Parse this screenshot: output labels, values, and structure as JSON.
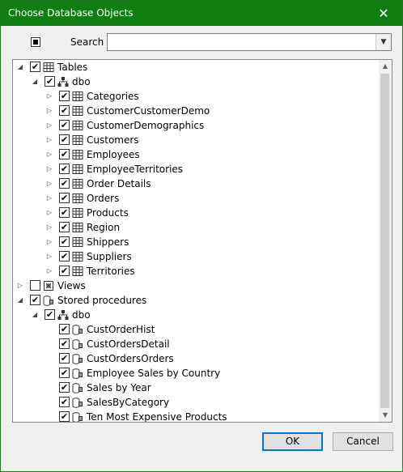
{
  "window": {
    "title": "Choose Database Objects"
  },
  "search": {
    "label": "Search",
    "value": ""
  },
  "buttons": {
    "ok": "OK",
    "cancel": "Cancel"
  },
  "tree": [
    {
      "level": 0,
      "expand": "expanded",
      "checked": true,
      "icon": "table-icon",
      "label": "Tables"
    },
    {
      "level": 1,
      "expand": "expanded",
      "checked": true,
      "icon": "schema-icon",
      "label": "dbo"
    },
    {
      "level": 2,
      "expand": "collapsed",
      "checked": true,
      "icon": "table-icon",
      "label": "Categories"
    },
    {
      "level": 2,
      "expand": "collapsed",
      "checked": true,
      "icon": "table-icon",
      "label": "CustomerCustomerDemo"
    },
    {
      "level": 2,
      "expand": "collapsed",
      "checked": true,
      "icon": "table-icon",
      "label": "CustomerDemographics"
    },
    {
      "level": 2,
      "expand": "collapsed",
      "checked": true,
      "icon": "table-icon",
      "label": "Customers"
    },
    {
      "level": 2,
      "expand": "collapsed",
      "checked": true,
      "icon": "table-icon",
      "label": "Employees"
    },
    {
      "level": 2,
      "expand": "collapsed",
      "checked": true,
      "icon": "table-icon",
      "label": "EmployeeTerritories"
    },
    {
      "level": 2,
      "expand": "collapsed",
      "checked": true,
      "icon": "table-icon",
      "label": "Order Details"
    },
    {
      "level": 2,
      "expand": "collapsed",
      "checked": true,
      "icon": "table-icon",
      "label": "Orders"
    },
    {
      "level": 2,
      "expand": "collapsed",
      "checked": true,
      "icon": "table-icon",
      "label": "Products"
    },
    {
      "level": 2,
      "expand": "collapsed",
      "checked": true,
      "icon": "table-icon",
      "label": "Region"
    },
    {
      "level": 2,
      "expand": "collapsed",
      "checked": true,
      "icon": "table-icon",
      "label": "Shippers"
    },
    {
      "level": 2,
      "expand": "collapsed",
      "checked": true,
      "icon": "table-icon",
      "label": "Suppliers"
    },
    {
      "level": 2,
      "expand": "collapsed",
      "checked": true,
      "icon": "table-icon",
      "label": "Territories"
    },
    {
      "level": 0,
      "expand": "collapsed",
      "checked": false,
      "icon": "view-icon",
      "label": "Views"
    },
    {
      "level": 0,
      "expand": "expanded",
      "checked": true,
      "icon": "procedure-icon",
      "label": "Stored procedures"
    },
    {
      "level": 1,
      "expand": "expanded",
      "checked": true,
      "icon": "schema-icon",
      "label": "dbo"
    },
    {
      "level": 2,
      "expand": "none",
      "checked": true,
      "icon": "procedure-icon",
      "label": "CustOrderHist"
    },
    {
      "level": 2,
      "expand": "none",
      "checked": true,
      "icon": "procedure-icon",
      "label": "CustOrdersDetail"
    },
    {
      "level": 2,
      "expand": "none",
      "checked": true,
      "icon": "procedure-icon",
      "label": "CustOrdersOrders"
    },
    {
      "level": 2,
      "expand": "none",
      "checked": true,
      "icon": "procedure-icon",
      "label": "Employee Sales by Country"
    },
    {
      "level": 2,
      "expand": "none",
      "checked": true,
      "icon": "procedure-icon",
      "label": "Sales by Year"
    },
    {
      "level": 2,
      "expand": "none",
      "checked": true,
      "icon": "procedure-icon",
      "label": "SalesByCategory"
    },
    {
      "level": 2,
      "expand": "none",
      "checked": true,
      "icon": "procedure-icon",
      "label": "Ten Most Expensive Products"
    }
  ]
}
